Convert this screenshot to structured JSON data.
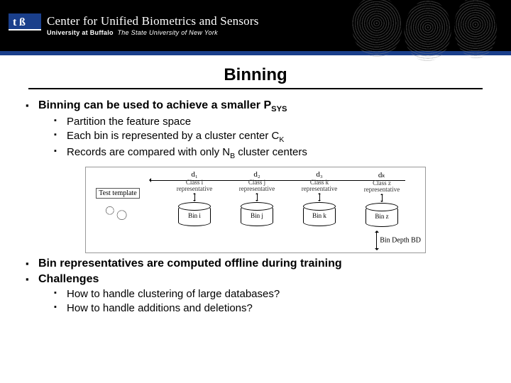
{
  "header": {
    "title": "Center for Unified Biometrics and Sensors",
    "subtitle_bold": "University at Buffalo",
    "subtitle_italic": "The State University of New York"
  },
  "slide": {
    "title": "Binning",
    "bullet1": "Binning can be used to achieve a smaller P",
    "bullet1_sub": "SYS",
    "bullet1_sub1": "Partition the feature space",
    "bullet1_sub2_a": "Each bin is represented by a cluster center C",
    "bullet1_sub2_b": "K",
    "bullet1_sub3_a": "Records are compared with only N",
    "bullet1_sub3_b": "B",
    "bullet1_sub3_c": " cluster centers",
    "bullet2": "Bin representatives are computed offline during training",
    "bullet3": "Challenges",
    "bullet3_sub1": "How to handle clustering of large databases?",
    "bullet3_sub2": "How to handle additions and deletions?"
  },
  "diagram": {
    "test_template": "Test template",
    "d1": "d₁",
    "d2": "d₂",
    "d3": "d₃",
    "dk": "dₖ",
    "rep_i": "Class i representative",
    "rep_j": "Class j representative",
    "rep_k": "Class k representative",
    "rep_z": "Class z representative",
    "bin_i": "Bin i",
    "bin_j": "Bin j",
    "bin_k": "Bin k",
    "bin_z": "Bin z",
    "bin_depth": "Bin Depth BD"
  }
}
